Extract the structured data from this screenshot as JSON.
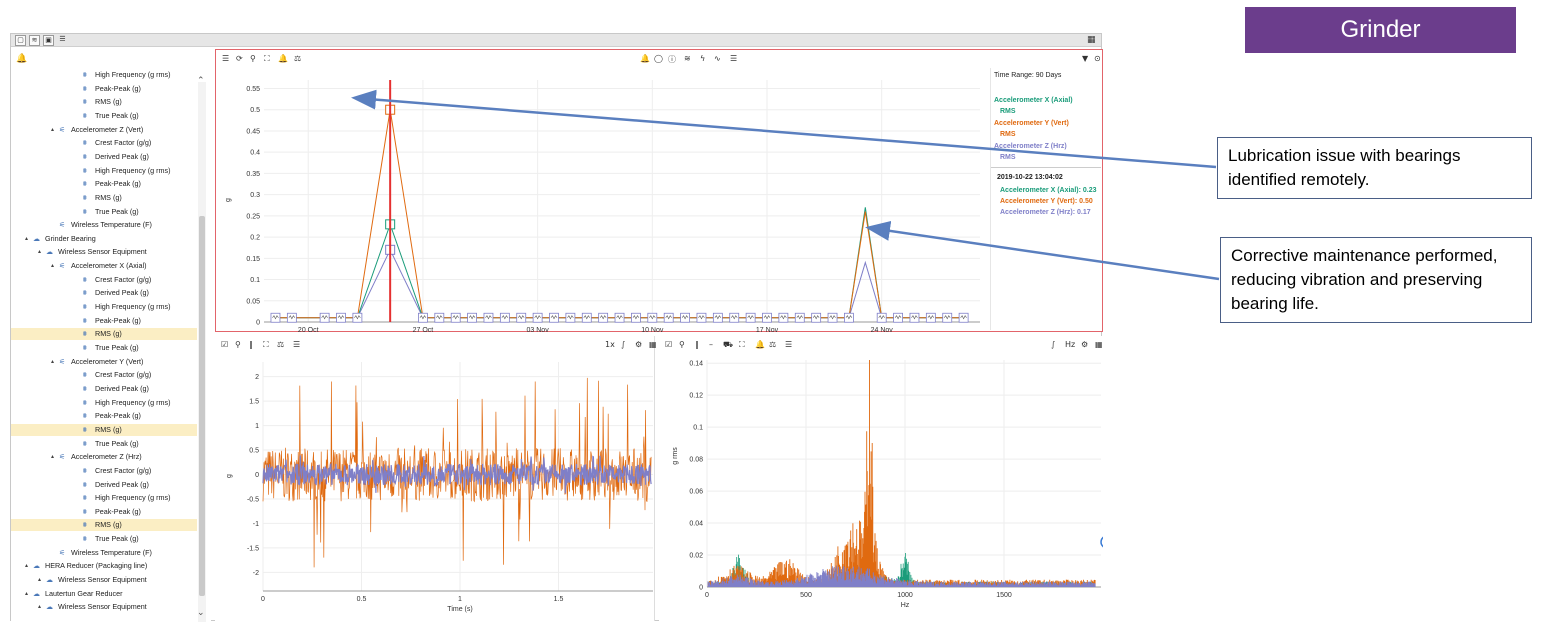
{
  "banner": {
    "title": "Grinder"
  },
  "callouts": [
    {
      "text": "Lubrication issue with bearings identified remotely."
    },
    {
      "text": "Corrective maintenance performed, reducing vibration and preserving bearing life."
    }
  ],
  "tree": [
    {
      "label": "High Frequency (g rms)",
      "level": 3,
      "selected": false
    },
    {
      "label": "Peak-Peak (g)",
      "level": 3,
      "selected": false
    },
    {
      "label": "RMS (g)",
      "level": 3,
      "selected": false
    },
    {
      "label": "True Peak (g)",
      "level": 3,
      "selected": false
    },
    {
      "label": "Accelerometer Z (Vert)",
      "level": 2,
      "selected": false
    },
    {
      "label": "Crest Factor (g/g)",
      "level": 3,
      "selected": false
    },
    {
      "label": "Derived Peak (g)",
      "level": 3,
      "selected": false
    },
    {
      "label": "High Frequency (g rms)",
      "level": 3,
      "selected": false
    },
    {
      "label": "Peak-Peak (g)",
      "level": 3,
      "selected": false
    },
    {
      "label": "RMS (g)",
      "level": 3,
      "selected": false
    },
    {
      "label": "True Peak (g)",
      "level": 3,
      "selected": false
    },
    {
      "label": "Wireless Temperature (F)",
      "level": 2,
      "selected": false
    },
    {
      "label": "Grinder Bearing",
      "level": 0,
      "selected": false
    },
    {
      "label": "Wireless Sensor Equipment",
      "level": 1,
      "selected": false
    },
    {
      "label": "Accelerometer X (Axial)",
      "level": 2,
      "selected": false
    },
    {
      "label": "Crest Factor (g/g)",
      "level": 3,
      "selected": false
    },
    {
      "label": "Derived Peak (g)",
      "level": 3,
      "selected": false
    },
    {
      "label": "High Frequency (g rms)",
      "level": 3,
      "selected": false
    },
    {
      "label": "Peak-Peak (g)",
      "level": 3,
      "selected": false
    },
    {
      "label": "RMS (g)",
      "level": 3,
      "selected": true
    },
    {
      "label": "True Peak (g)",
      "level": 3,
      "selected": false
    },
    {
      "label": "Accelerometer Y (Vert)",
      "level": 2,
      "selected": false
    },
    {
      "label": "Crest Factor (g/g)",
      "level": 3,
      "selected": false
    },
    {
      "label": "Derived Peak (g)",
      "level": 3,
      "selected": false
    },
    {
      "label": "High Frequency (g rms)",
      "level": 3,
      "selected": false
    },
    {
      "label": "Peak-Peak (g)",
      "level": 3,
      "selected": false
    },
    {
      "label": "RMS (g)",
      "level": 3,
      "selected": true
    },
    {
      "label": "True Peak (g)",
      "level": 3,
      "selected": false
    },
    {
      "label": "Accelerometer Z (Hrz)",
      "level": 2,
      "selected": false
    },
    {
      "label": "Crest Factor (g/g)",
      "level": 3,
      "selected": false
    },
    {
      "label": "Derived Peak (g)",
      "level": 3,
      "selected": false
    },
    {
      "label": "High Frequency (g rms)",
      "level": 3,
      "selected": false
    },
    {
      "label": "Peak-Peak (g)",
      "level": 3,
      "selected": false
    },
    {
      "label": "RMS (g)",
      "level": 3,
      "selected": true
    },
    {
      "label": "True Peak (g)",
      "level": 3,
      "selected": false
    },
    {
      "label": "Wireless Temperature (F)",
      "level": 2,
      "selected": false
    },
    {
      "label": "HERA Reducer (Packaging line)",
      "level": 0,
      "selected": false
    },
    {
      "label": "Wireless Sensor Equipment",
      "level": 1,
      "selected": false
    },
    {
      "label": "Lautertun Gear Reducer",
      "level": 0,
      "selected": false
    },
    {
      "label": "Wireless Sensor Equipment",
      "level": 1,
      "selected": false
    }
  ],
  "trend_panel": {
    "legend": {
      "time_range": "Time Range: 90 Days",
      "series": [
        {
          "name": "Accelerometer X (Axial)",
          "sub": "RMS",
          "color": "#1a9c7a"
        },
        {
          "name": "Accelerometer Y (Vert)",
          "sub": "RMS",
          "color": "#e06a10"
        },
        {
          "name": "Accelerometer Z (Hrz)",
          "sub": "RMS",
          "color": "#7f7fc8"
        }
      ],
      "cursor_time": "2019-10-22 13:04:02",
      "cursor_values": [
        "Accelerometer X (Axial): 0.23",
        "Accelerometer Y (Vert): 0.50",
        "Accelerometer Z (Hrz): 0.17"
      ]
    }
  },
  "wave_panel": {
    "speed_label": "1x"
  },
  "spec_panel": {
    "unit_label": "Hz"
  },
  "chart_data": [
    {
      "type": "line",
      "ylabel": "g",
      "ylim": [
        0,
        0.57
      ],
      "yticks": [
        0.05,
        0.1,
        0.15,
        0.2,
        0.25,
        0.3,
        0.35,
        0.4,
        0.45,
        0.5,
        0.55
      ],
      "xticks": [
        "20 Oct",
        "27 Oct",
        "03 Nov",
        "10 Nov",
        "17 Nov",
        "24 Nov"
      ],
      "x_days_from_20oct": [
        -2,
        -1,
        1,
        2,
        3,
        5,
        7,
        8,
        9,
        10,
        11,
        12,
        13,
        14,
        15,
        16,
        17,
        18,
        19,
        20,
        21,
        22,
        23,
        24,
        25,
        26,
        27,
        28,
        29,
        30,
        31,
        32,
        33,
        34,
        35,
        36,
        37,
        38,
        39,
        40
      ],
      "series": [
        {
          "name": "Accelerometer X (Axial)",
          "color": "#1a9c7a",
          "spike1": 0.23,
          "spike2": 0.27,
          "base": 0.01
        },
        {
          "name": "Accelerometer Y (Vert)",
          "color": "#e06a10",
          "spike1": 0.5,
          "spike2": 0.26,
          "base": 0.01
        },
        {
          "name": "Accelerometer Z (Hrz)",
          "color": "#7f7fc8",
          "spike1": 0.17,
          "spike2": 0.14,
          "base": 0.01
        }
      ],
      "spike_days": [
        5,
        34
      ],
      "cursor_day": 5
    },
    {
      "type": "line",
      "xlabel": "Time (s)",
      "ylabel": "g",
      "xlim": [
        0,
        2
      ],
      "ylim": [
        -2.3,
        2.3
      ],
      "yticks": [
        2,
        1.5,
        1,
        0.5,
        0,
        -0.5,
        -1,
        -1.5,
        -2
      ],
      "xticks": [
        0,
        0.5,
        1,
        1.5
      ],
      "series": [
        {
          "name": "Accelerometer Y (Vert)",
          "color": "#e06a10",
          "amplitude": 0.55,
          "peak": 2.0
        },
        {
          "name": "Accelerometer Z (Hrz)",
          "color": "#7f7fc8",
          "amplitude": 0.22,
          "peak": 0.4
        }
      ]
    },
    {
      "type": "line",
      "xlabel": "Hz",
      "ylabel": "g rms",
      "xlim": [
        0,
        2000
      ],
      "ylim": [
        0,
        0.142
      ],
      "yticks": [
        0.14,
        0.12,
        0.1,
        0.08,
        0.06,
        0.04,
        0.02,
        0
      ],
      "xticks": [
        0,
        500,
        1000,
        1500
      ],
      "series": [
        {
          "name": "Accelerometer Y (Vert)",
          "color": "#e06a10",
          "peak_hz": 820,
          "peak": 0.13
        },
        {
          "name": "Accelerometer X (Axial)",
          "color": "#1a9c7a",
          "peak_hz": 1000,
          "peak": 0.025
        },
        {
          "name": "Accelerometer Z (Hrz)",
          "color": "#7f7fc8",
          "peak_hz": 850,
          "peak": 0.01
        }
      ]
    }
  ]
}
